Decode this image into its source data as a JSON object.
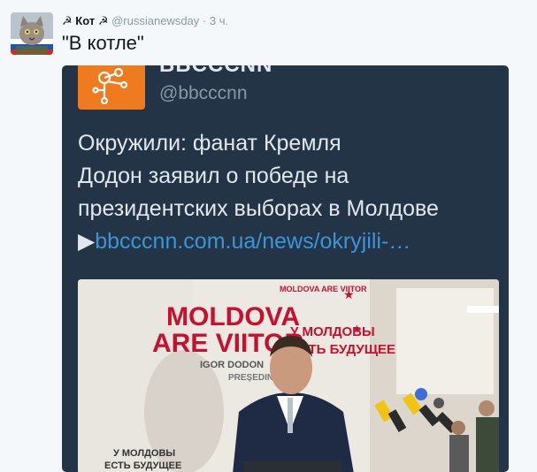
{
  "tweet": {
    "author_name": "Кот",
    "author_handle": "@russianewsday",
    "separator": "·",
    "time": "3 ч.",
    "text": "\"В котле\""
  },
  "card": {
    "name": "BBCCCNN",
    "handle": "@bbcccnn",
    "lines": [
      "Окружили: фанат Кремля",
      "Додон заявил о победе на",
      "президентских выборах в Молдове"
    ],
    "link_arrow": "▶",
    "link": "bbcccnn.com.ua/news/okryjili-…"
  },
  "photo": {
    "banner_line1": "MOLDOVA",
    "banner_line2": "ARE VIITOR",
    "banner_sub1": "IGOR DODON",
    "banner_sub2": "PREȘEDINTE",
    "banner_ru1": "У МОЛДОВЫ",
    "banner_ru2": "ЕСТЬ БУДУЩЕЕ",
    "side_top": "MOLDOVA ARE VIITOR",
    "side_mid1": "У МОЛДОВЫ",
    "side_mid2": "ЕСТЬ БУДУЩЕЕ",
    "accent": "#c8102e"
  },
  "colors": {
    "background": "#f5f8fa",
    "card_bg": "#243447",
    "card_avatar": "#f07a1e",
    "link": "#3b94d9"
  },
  "icons": [
    "user-avatar",
    "hammer-sickle-icon",
    "bbcccnn-logo",
    "link-arrow-icon"
  ]
}
